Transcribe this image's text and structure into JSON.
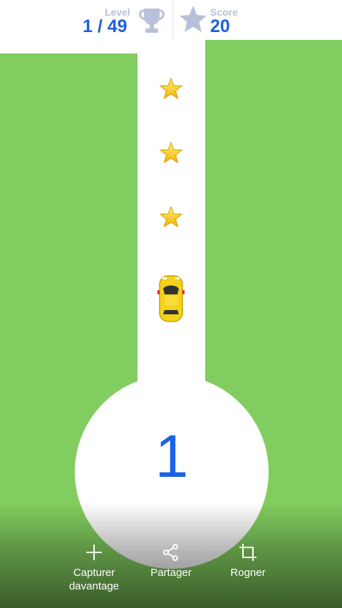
{
  "hud": {
    "level_caption": "Level",
    "level_value": "1 / 49",
    "score_caption": "Score",
    "score_value": "20",
    "trophy_icon": "trophy-icon",
    "star_icon": "star-icon"
  },
  "game": {
    "countdown": "1",
    "collectibles": [
      "star-icon",
      "star-icon",
      "star-icon"
    ],
    "player": "yellow-car"
  },
  "actions": [
    {
      "label": "Capturer\ndavantage",
      "icon": "plus-icon"
    },
    {
      "label": "Partager",
      "icon": "share-icon"
    },
    {
      "label": "Rogner",
      "icon": "crop-icon"
    }
  ],
  "colors": {
    "grass": "#82cd5f",
    "road": "#ffffff",
    "accent_text": "#1f5fde",
    "caption": "#b9c0d9",
    "car": "#f5d21a"
  }
}
